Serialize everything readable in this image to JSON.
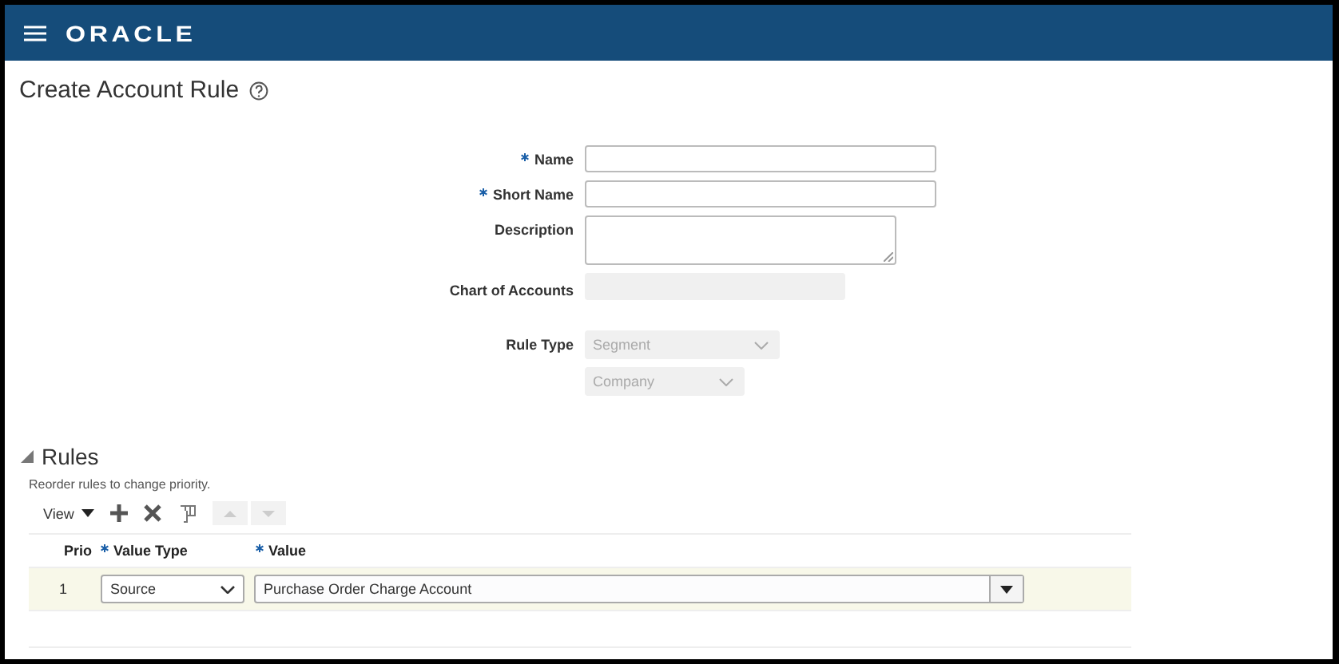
{
  "header": {
    "logo": "ORACLE"
  },
  "page": {
    "title": "Create Account Rule"
  },
  "form": [
    {
      "label": "Name",
      "required": true,
      "kind": "text",
      "disabled": false
    },
    {
      "label": "Short Name",
      "required": true,
      "kind": "text",
      "disabled": false
    },
    {
      "label": "Description",
      "required": false,
      "kind": "textarea",
      "disabled": false
    },
    {
      "label": "Chart of Accounts",
      "required": false,
      "kind": "text",
      "disabled": true
    },
    {
      "label": "Rule Type",
      "required": false,
      "kind": "select",
      "disabled": true,
      "value": "Segment"
    },
    {
      "kind": "select",
      "disabled": true,
      "value": "Company"
    }
  ],
  "rules": {
    "title": "Rules",
    "expanded": true,
    "hint": "Reorder rules to change priority.",
    "view_menu": "View",
    "columns": [
      {
        "label": "Prio",
        "required": false
      },
      {
        "label": "Value Type",
        "required": true
      },
      {
        "label": "Value",
        "required": true
      }
    ],
    "rows": [
      {
        "priority": "1",
        "value_type": "Source",
        "value": "Purchase Order Charge Account"
      }
    ]
  }
}
